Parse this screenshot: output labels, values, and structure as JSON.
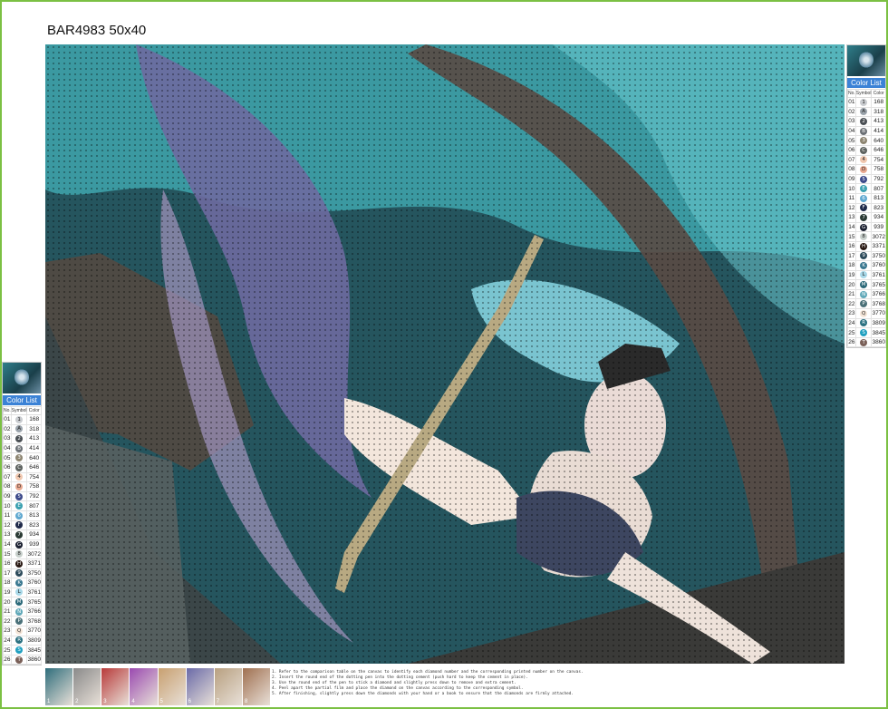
{
  "title": "BAR4983 50x40",
  "panel": {
    "header": "Color List",
    "columns": [
      "No.",
      "Symbol",
      "Color"
    ]
  },
  "colors": [
    {
      "no": "01",
      "sym": "1",
      "code": "168",
      "hex": "#c9ccd0"
    },
    {
      "no": "02",
      "sym": "A",
      "code": "318",
      "hex": "#9aa3ab"
    },
    {
      "no": "03",
      "sym": "2",
      "code": "413",
      "hex": "#4a4f54"
    },
    {
      "no": "04",
      "sym": "B",
      "code": "414",
      "hex": "#6b7075"
    },
    {
      "no": "05",
      "sym": "3",
      "code": "640",
      "hex": "#8d8571"
    },
    {
      "no": "06",
      "sym": "C",
      "code": "646",
      "hex": "#5e6360"
    },
    {
      "no": "07",
      "sym": "4",
      "code": "754",
      "hex": "#f0c8b0"
    },
    {
      "no": "08",
      "sym": "D",
      "code": "758",
      "hex": "#e8a890"
    },
    {
      "no": "09",
      "sym": "5",
      "code": "792",
      "hex": "#3d4a8a"
    },
    {
      "no": "10",
      "sym": "E",
      "code": "807",
      "hex": "#3aa0b0"
    },
    {
      "no": "11",
      "sym": "6",
      "code": "813",
      "hex": "#5fa8d0"
    },
    {
      "no": "12",
      "sym": "F",
      "code": "823",
      "hex": "#1f2a4a"
    },
    {
      "no": "13",
      "sym": "7",
      "code": "934",
      "hex": "#2a3a34"
    },
    {
      "no": "14",
      "sym": "G",
      "code": "939",
      "hex": "#1a2030"
    },
    {
      "no": "15",
      "sym": "8",
      "code": "3072",
      "hex": "#c8d0cc"
    },
    {
      "no": "16",
      "sym": "H",
      "code": "3371",
      "hex": "#2a1a14"
    },
    {
      "no": "17",
      "sym": "9",
      "code": "3750",
      "hex": "#2c4a5a"
    },
    {
      "no": "18",
      "sym": "K",
      "code": "3760",
      "hex": "#3a7890"
    },
    {
      "no": "19",
      "sym": "L",
      "code": "3761",
      "hex": "#a8d8e8"
    },
    {
      "no": "20",
      "sym": "M",
      "code": "3765",
      "hex": "#2a6878"
    },
    {
      "no": "21",
      "sym": "N",
      "code": "3766",
      "hex": "#60a8b8"
    },
    {
      "no": "22",
      "sym": "P",
      "code": "3768",
      "hex": "#4a7078"
    },
    {
      "no": "23",
      "sym": "Q",
      "code": "3770",
      "hex": "#f5e6d8"
    },
    {
      "no": "24",
      "sym": "R",
      "code": "3809",
      "hex": "#2a7080"
    },
    {
      "no": "25",
      "sym": "S",
      "code": "3845",
      "hex": "#20a0c0"
    },
    {
      "no": "26",
      "sym": "T",
      "code": "3860",
      "hex": "#7a6058"
    }
  ],
  "steps": [
    {
      "n": "1",
      "bg": "#2f6e7c"
    },
    {
      "n": "2",
      "bg": "#8a8a8a"
    },
    {
      "n": "3",
      "bg": "#b83a3a"
    },
    {
      "n": "4",
      "bg": "#9a4ab0"
    },
    {
      "n": "5",
      "bg": "#c8a070"
    },
    {
      "n": "6",
      "bg": "#6a6aa8"
    },
    {
      "n": "7",
      "bg": "#b8a080"
    },
    {
      "n": "8",
      "bg": "#a07050"
    }
  ],
  "instructions": [
    "1. Refer to the comparison table on the canvas to identify each diamond number and the corresponding printed number on the canvas.",
    "2. Insert the round end of the dotting pen into the dotting cement (push hard to keep the cement in place).",
    "3. Use the round end of the pen to stick a diamond and slightly press down to remove and extra cement.",
    "4. Peel apart the partial film and place the diamond on the canvas according to the corresponding symbol.",
    "5. After finishing, slightly press down the diamonds with your hand or a book to ensure that the diamonds are firmly attached."
  ]
}
